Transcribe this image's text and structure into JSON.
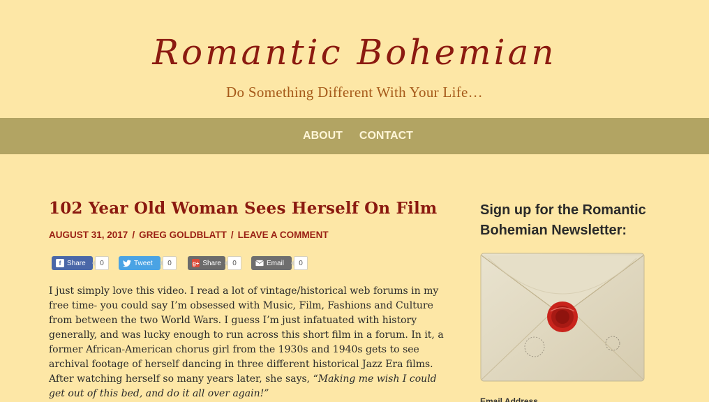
{
  "site": {
    "title": "Romantic Bohemian",
    "tagline": "Do Something Different With Your Life…"
  },
  "nav": {
    "items": [
      {
        "label": "ABOUT"
      },
      {
        "label": "CONTACT"
      }
    ]
  },
  "post": {
    "title": "102 Year Old Woman Sees Herself On Film",
    "date": "AUGUST 31, 2017",
    "author": "GREG GOLDBLATT",
    "comment_link": "LEAVE A COMMENT",
    "separator": "/",
    "body_plain": "I just simply love this video. I read a lot of vintage/historical web forums in my free time- you could say I’m obsessed with Music, Film, Fashions and Culture from between the two World Wars. I guess I’m just infatuated with history generally, and was lucky enough to run across this short film in a forum. In it, a former African-American chorus girl from the 1930s and 1940s gets to see archival footage of herself dancing in three different historical Jazz Era films. After watching herself so many years later, she says, ",
    "body_quote": "“Making me wish I could get out of this bed, and do it all over again!”"
  },
  "share": {
    "facebook": {
      "label": "Share",
      "count": "0",
      "icon": "facebook-icon",
      "color": "#4a67a8"
    },
    "twitter": {
      "label": "Tweet",
      "count": "0",
      "icon": "twitter-icon",
      "color": "#4aa3e4"
    },
    "googleplus": {
      "label": "Share",
      "count": "0",
      "icon": "google-plus-icon",
      "color": "#6b6b6b"
    },
    "email": {
      "label": "Email",
      "count": "0",
      "icon": "email-icon",
      "color": "#6e6e6e"
    }
  },
  "sidebar": {
    "widget_title": "Sign up for the Romantic Bohemian Newsletter:",
    "email_label": "Email Address"
  },
  "colors": {
    "background": "#fde7a6",
    "nav_bar": "#b2a463",
    "title_red": "#8b1a10",
    "tagline_brown": "#a65a1a"
  }
}
